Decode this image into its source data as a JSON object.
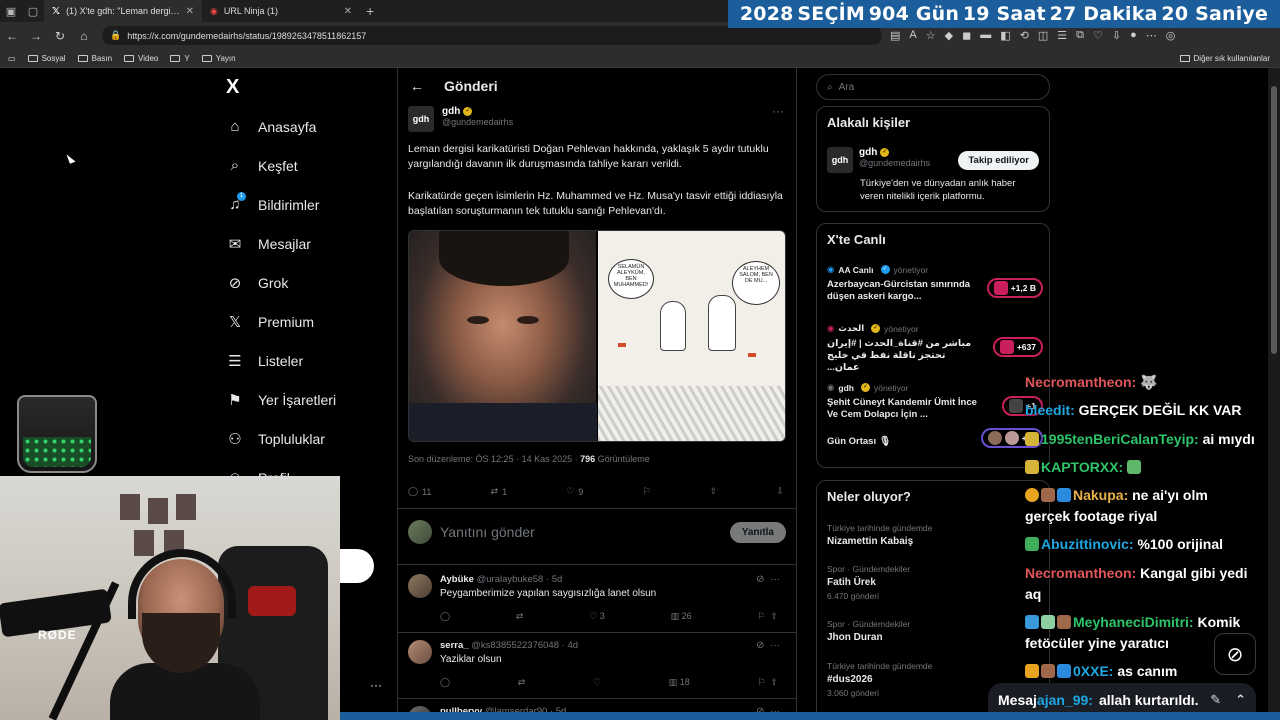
{
  "browser": {
    "tabs": [
      {
        "label": "(1) X'te gdh: \"Leman dergisi karikatüristi...",
        "active": true
      },
      {
        "label": "URL Ninja (1)",
        "active": false
      }
    ],
    "url": "https://x.com/gundemedairhs/status/1989263478511862157",
    "bookmarks": [
      "Sosyal",
      "Basın",
      "Video",
      "Y",
      "Yayın"
    ],
    "bookmarks_other": "Diğer sık kullanılanlar"
  },
  "countdown": {
    "year": "2028",
    "label": "SEÇİM",
    "days": "904 Gün",
    "hours": "19 Saat",
    "minutes": "27 Dakika",
    "seconds": "20 Saniye",
    "color": "#1b5e9b"
  },
  "x_nav": {
    "logo": "X",
    "items": [
      {
        "label": "Anasayfa",
        "icon": "home-icon"
      },
      {
        "label": "Keşfet",
        "icon": "search-icon"
      },
      {
        "label": "Bildirimler",
        "icon": "bell-icon",
        "badge": "1"
      },
      {
        "label": "Mesajlar",
        "icon": "mail-icon"
      },
      {
        "label": "Grok",
        "icon": "grok-icon"
      },
      {
        "label": "Premium",
        "icon": "x-icon"
      },
      {
        "label": "Listeler",
        "icon": "list-icon"
      },
      {
        "label": "Yer İşaretleri",
        "icon": "bookmark-icon"
      },
      {
        "label": "Topluluklar",
        "icon": "people-icon"
      },
      {
        "label": "Profil",
        "icon": "person-icon"
      }
    ]
  },
  "post": {
    "header": "Gönderi",
    "author_name": "gdh",
    "author_handle": "@gundemedairhs",
    "avatar_text": "gdh",
    "text_1": "Leman dergisi karikatüristi Doğan Pehlevan hakkında, yaklaşık 5 aydır tutuklu yargılandığı davanın ilk duruşmasında tahliye kararı verildi.",
    "text_2": "Karikatürde geçen isimlerin Hz. Muhammed ve Hz. Musa'yı tasvir ettiği iddiasıyla başlatılan soruşturmanın tek tutuklu sanığı Pehlevan'dı.",
    "cartoon_bubble_1": "SELAMÜN ALEYKÜM, BEN MUHAMMED!",
    "cartoon_bubble_2": "ALEYHEM SALOM, BEN DE MU...",
    "meta_edited": "Son düzenleme: ÖS 12:25 · 14 Kas 2025 ·",
    "views": "796",
    "views_label": "Görüntüleme",
    "replies": "11",
    "reposts": "1",
    "likes": "9",
    "reply_placeholder": "Yanıtını gönder",
    "reply_button": "Yanıtla"
  },
  "replies": [
    {
      "name": "Aybüke",
      "handle": "@uralaybuke58 · 5d",
      "text": "Peygamberimize yapılan saygısızlığa lanet olsun",
      "reposts": "",
      "likes": "3",
      "views": "26"
    },
    {
      "name": "serra_",
      "handle": "@ks8385522376048 · 4d",
      "text": "Yaziklar olsun",
      "reposts": "",
      "likes": "",
      "views": "18"
    },
    {
      "name": "pullberyy",
      "handle": "@lamserdar90 · 5d",
      "text": "",
      "reposts": "",
      "likes": "",
      "views": ""
    }
  ],
  "right": {
    "search_placeholder": "Ara",
    "related_title": "Alakalı kişiler",
    "related_name": "gdh",
    "related_handle": "@gundemedairhs",
    "related_bio": "Türkiye'den ve dünyadan anlık haber veren nitelikli içerik platformu.",
    "follow_label": "Takip ediliyor",
    "live_title": "X'te Canlı",
    "live": [
      {
        "source": "AA Canlı",
        "role": "yönetiyor",
        "title": "Azerbaycan-Gürcistan sınırında düşen askeri kargo...",
        "count": "+1,2 B"
      },
      {
        "source": "الحدث",
        "role": "yönetiyor",
        "title": "مباشر من #قناة_الحدث | #إيران تحتجز ناقلة نفط في خليج عمان...",
        "count": "+637"
      },
      {
        "source": "gdh",
        "role": "yönetiyor",
        "title": "Şehit Cüneyt Kandemir Ümit İnce Ve Cem Dolapcı İçin ...",
        "count": "+1"
      },
      {
        "source": "",
        "role": "",
        "title": "Gün Ortası 🎙",
        "count": "+30"
      }
    ],
    "trends_title": "Neler oluyor?",
    "trends": [
      {
        "cat": "Türkiye tarihinde gündemde",
        "name": "Nizamettin Kabaiş",
        "count": ""
      },
      {
        "cat": "Spor · Gündemdekiler",
        "name": "Fatih Ürek",
        "count": "6.470 gönderi"
      },
      {
        "cat": "Spor · Gündemdekiler",
        "name": "Jhon Duran",
        "count": ""
      },
      {
        "cat": "Türkiye tarihinde gündemde",
        "name": "#dus2026",
        "count": "3.060 gönderi"
      }
    ]
  },
  "chat": [
    {
      "user": "Necromantheon:",
      "msg": "🐺",
      "color": "#e0565a"
    },
    {
      "user": "bleedit:",
      "msg": "GERÇEK DEĞİL KK VAR",
      "color": "#1ea7e1"
    },
    {
      "user": "1995tenBeriCalanTeyip:",
      "msg": "ai mıydı",
      "color": "#2ec46a"
    },
    {
      "user": "KAPTORXX:",
      "msg": "",
      "color": "#2ec46a"
    },
    {
      "user": "Nakupa:",
      "msg": "ne ai'yı olm",
      "color": "#e8b24a"
    },
    {
      "user": "",
      "msg": "gerçek footage riyal",
      "color": "#ffffff"
    },
    {
      "user": "Abuzittinovic:",
      "msg": "%100 orijinal",
      "color": "#1ea7e1"
    },
    {
      "user": "Necromantheon:",
      "msg": "Kangal gibi yedi",
      "color": "#e0565a"
    },
    {
      "user": "",
      "msg": "aq",
      "color": "#ffffff"
    },
    {
      "user": "MeyhaneciDimitri:",
      "msg": "Komik",
      "color": "#2ec46a"
    },
    {
      "user": "",
      "msg": "fetöcüler yine yaratıcı",
      "color": "#ffffff"
    },
    {
      "user": "0XXE:",
      "msg": "as canım",
      "color": "#1ea7e1"
    },
    {
      "user": "ajan_99:",
      "msg": "allah kurtarıldı.",
      "color": "#1ea7e1"
    }
  ],
  "chat_input_placeholder": "Mesaj",
  "webcam_mic_brand": "RØDE"
}
